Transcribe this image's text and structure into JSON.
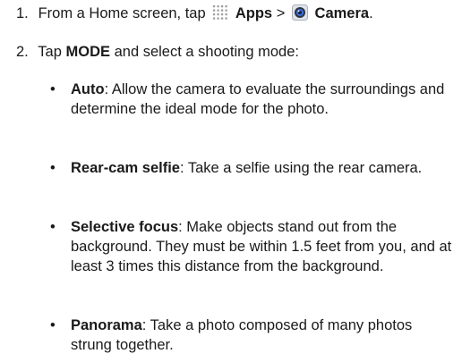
{
  "steps": [
    {
      "number": "1.",
      "prefix": "From a Home screen, tap",
      "apps_label": "Apps",
      "separator": ">",
      "camera_label": "Camera",
      "suffix": ".",
      "icons": [
        "apps-grid-icon",
        "camera-app-icon"
      ]
    },
    {
      "number": "2.",
      "prefix": "Tap",
      "mode_label": "MODE",
      "suffix": "and select a shooting mode:"
    }
  ],
  "modes": [
    {
      "name": "Auto",
      "description": ": Allow the camera to evaluate the surroundings and determine the ideal mode for the photo."
    },
    {
      "name": "Rear-cam selfie",
      "description": ": Take a selfie using the rear camera."
    },
    {
      "name": "Selective focus",
      "description": ": Make objects stand out from the background. They must be within 1.5 feet from you, and at least 3 times this distance from the background."
    },
    {
      "name": "Panorama",
      "description": ": Take a photo composed of many photos strung together."
    }
  ],
  "bullet_char": "•"
}
